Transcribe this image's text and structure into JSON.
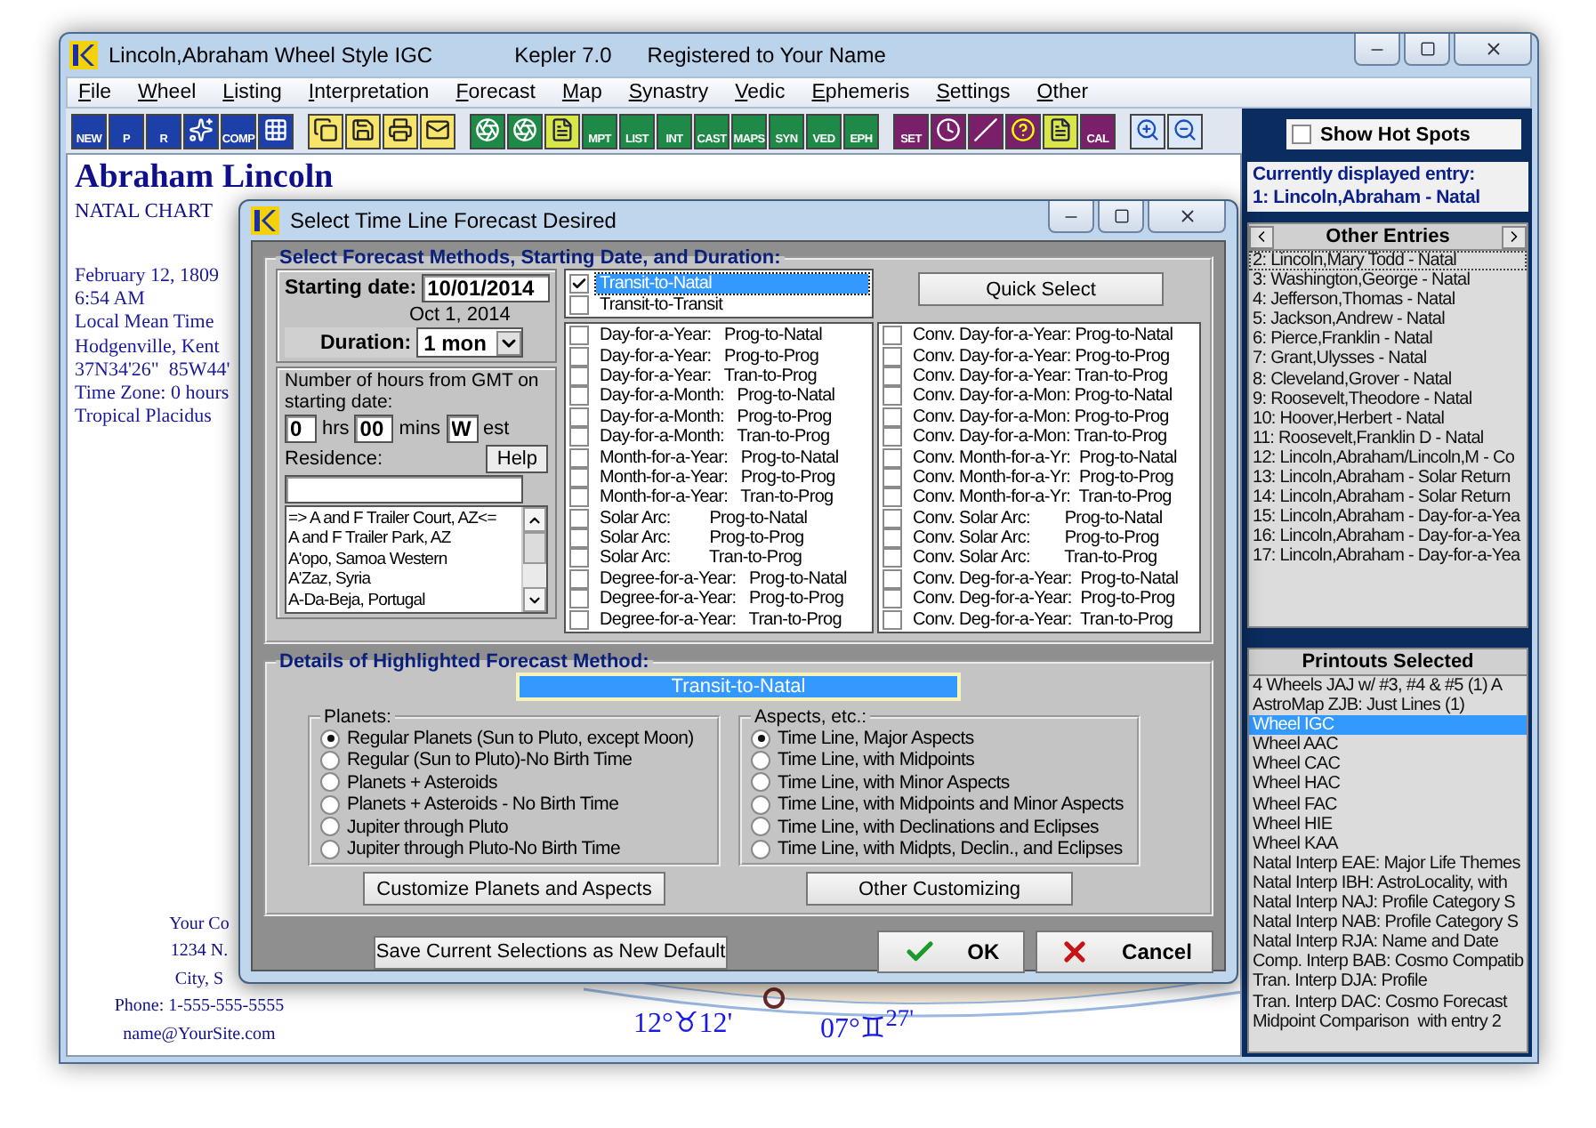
{
  "window": {
    "title": "Lincoln,Abraham Wheel Style IGC",
    "app": "Kepler 7.0",
    "registration": "Registered to Your Name"
  },
  "menu": [
    "File",
    "Wheel",
    "Listing",
    "Interpretation",
    "Forecast",
    "Map",
    "Synastry",
    "Vedic",
    "Ephemeris",
    "Settings",
    "Other"
  ],
  "toolbar_labels": [
    "NEW",
    "P",
    "R",
    "COMP",
    "MPT",
    "LIST",
    "INT",
    "CAST",
    "MAPS",
    "SYN",
    "VED",
    "EPH",
    "SET",
    "CAL"
  ],
  "chart": {
    "name": "Abraham Lincoln",
    "type": "NATAL CHART",
    "details": [
      "February 12, 1809",
      "6:54 AM",
      "Local Mean Time",
      "Hodgenville, Kent",
      "37N34'26\"  85W44'",
      "Time Zone: 0 hours",
      "Tropical Placidus"
    ],
    "contact": [
      "Your Co",
      "1234 N.",
      "City, S",
      "Phone: 1-555-555-5555",
      "name@YourSite.com"
    ],
    "degree_labels": [
      "12°♉12'",
      "07°♊$^{27'}$"
    ]
  },
  "sidebar": {
    "hot_spots": {
      "label": "Show Hot Spots",
      "checked": false
    },
    "current_label": "Currently displayed entry:",
    "current_entry": "1: Lincoln,Abraham - Natal",
    "entries_title": "Other Entries",
    "entries": [
      {
        "label": "2: Lincoln,Mary Todd - Natal",
        "focused": true
      },
      {
        "label": "3: Washington,George - Natal",
        "focused": false
      },
      {
        "label": "4: Jefferson,Thomas - Natal",
        "focused": false
      },
      {
        "label": "5: Jackson,Andrew - Natal",
        "focused": false
      },
      {
        "label": "6: Pierce,Franklin - Natal",
        "focused": false
      },
      {
        "label": "7: Grant,Ulysses - Natal",
        "focused": false
      },
      {
        "label": "8: Cleveland,Grover - Natal",
        "focused": false
      },
      {
        "label": "9: Roosevelt,Theodore - Natal",
        "focused": false
      },
      {
        "label": "10: Hoover,Herbert - Natal",
        "focused": false
      },
      {
        "label": "11: Roosevelt,Franklin D - Natal",
        "focused": false
      },
      {
        "label": "12: Lincoln,Abraham/Lincoln,M - Co",
        "focused": false
      },
      {
        "label": "13: Lincoln,Abraham - Solar Return",
        "focused": false
      },
      {
        "label": "14: Lincoln,Abraham - Solar Return",
        "focused": false
      },
      {
        "label": "15: Lincoln,Abraham - Day-for-a-Yea",
        "focused": false
      },
      {
        "label": "16: Lincoln,Abraham - Day-for-a-Yea",
        "focused": false
      },
      {
        "label": "17: Lincoln,Abraham - Day-for-a-Yea",
        "focused": false
      }
    ],
    "printouts_title": "Printouts Selected",
    "printouts": [
      {
        "label": "4 Wheels JAJ w/ #3, #4 & #5 (1) A",
        "selected": false
      },
      {
        "label": "AstroMap ZJB: Just Lines (1)",
        "selected": false
      },
      {
        "label": "Wheel IGC",
        "selected": true
      },
      {
        "label": "Wheel AAC",
        "selected": false
      },
      {
        "label": "Wheel CAC",
        "selected": false
      },
      {
        "label": "Wheel HAC",
        "selected": false
      },
      {
        "label": "Wheel FAC",
        "selected": false
      },
      {
        "label": "Wheel HIE",
        "selected": false
      },
      {
        "label": "Wheel KAA",
        "selected": false
      },
      {
        "label": "Natal Interp EAE: Major Life Themes",
        "selected": false
      },
      {
        "label": "Natal Interp IBH: AstroLocality, with",
        "selected": false
      },
      {
        "label": "Natal Interp NAJ: Profile Category S",
        "selected": false
      },
      {
        "label": "Natal Interp NAB: Profile Category S",
        "selected": false
      },
      {
        "label": "Natal Interp RJA: Name and Date",
        "selected": false
      },
      {
        "label": "Comp. Interp BAB: Cosmo Compatib",
        "selected": false
      },
      {
        "label": "Tran. Interp DJA: Profile",
        "selected": false
      },
      {
        "label": "Tran. Interp DAC: Cosmo Forecast",
        "selected": false
      },
      {
        "label": "Midpoint Comparison  with entry 2",
        "selected": false
      }
    ]
  },
  "dialog": {
    "title": "Select Time Line Forecast Desired",
    "methods_title": "Select Forecast Methods, Starting Date, and Duration:",
    "starting_date_label": "Starting date:",
    "starting_date": "10/01/2014",
    "date_text": "Oct 1, 2014",
    "duration_label": "Duration:",
    "duration": "1 mon",
    "gmt_label": "Number of hours from GMT on starting date:",
    "hours": "0",
    "hours_unit": "hrs",
    "minutes": "00",
    "minutes_unit": "mins",
    "direction": "W",
    "direction_unit": "est",
    "residence_label": "Residence:",
    "help_button": "Help",
    "residences": [
      "=> A and F Trailer Court, AZ<=",
      "A and F Trailer Park, AZ",
      "A'opo, Samoa Western",
      "A'Zaz, Syria",
      "A-Da-Beja, Portugal"
    ],
    "transit_methods": [
      {
        "label": "Transit-to-Natal",
        "checked": true,
        "selected": true
      },
      {
        "label": "Transit-to-Transit",
        "checked": false,
        "selected": false
      }
    ],
    "quick_select": "Quick Select",
    "methods_left": [
      {
        "label": "Day-for-a-Year:   Prog-to-Natal",
        "checked": false
      },
      {
        "label": "Day-for-a-Year:   Prog-to-Prog",
        "checked": false
      },
      {
        "label": "Day-for-a-Year:   Tran-to-Prog",
        "checked": false
      },
      {
        "label": "Day-for-a-Month:   Prog-to-Natal",
        "checked": false
      },
      {
        "label": "Day-for-a-Month:   Prog-to-Prog",
        "checked": false
      },
      {
        "label": "Day-for-a-Month:   Tran-to-Prog",
        "checked": false
      },
      {
        "label": "Month-for-a-Year:   Prog-to-Natal",
        "checked": false
      },
      {
        "label": "Month-for-a-Year:   Prog-to-Prog",
        "checked": false
      },
      {
        "label": "Month-for-a-Year:   Tran-to-Prog",
        "checked": false
      },
      {
        "label": "Solar Arc:         Prog-to-Natal",
        "checked": false
      },
      {
        "label": "Solar Arc:         Prog-to-Prog",
        "checked": false
      },
      {
        "label": "Solar Arc:         Tran-to-Prog",
        "checked": false
      },
      {
        "label": "Degree-for-a-Year:   Prog-to-Natal",
        "checked": false
      },
      {
        "label": "Degree-for-a-Year:   Prog-to-Prog",
        "checked": false
      },
      {
        "label": "Degree-for-a-Year:   Tran-to-Prog",
        "checked": false
      }
    ],
    "methods_right": [
      {
        "label": "Conv. Day-for-a-Year: Prog-to-Natal",
        "checked": false
      },
      {
        "label": "Conv. Day-for-a-Year: Prog-to-Prog",
        "checked": false
      },
      {
        "label": "Conv. Day-for-a-Year: Tran-to-Prog",
        "checked": false
      },
      {
        "label": "Conv. Day-for-a-Mon: Prog-to-Natal",
        "checked": false
      },
      {
        "label": "Conv. Day-for-a-Mon: Prog-to-Prog",
        "checked": false
      },
      {
        "label": "Conv. Day-for-a-Mon: Tran-to-Prog",
        "checked": false
      },
      {
        "label": "Conv. Month-for-a-Yr:  Prog-to-Natal",
        "checked": false
      },
      {
        "label": "Conv. Month-for-a-Yr:  Prog-to-Prog",
        "checked": false
      },
      {
        "label": "Conv. Month-for-a-Yr:  Tran-to-Prog",
        "checked": false
      },
      {
        "label": "Conv. Solar Arc:        Prog-to-Natal",
        "checked": false
      },
      {
        "label": "Conv. Solar Arc:        Prog-to-Prog",
        "checked": false
      },
      {
        "label": "Conv. Solar Arc:        Tran-to-Prog",
        "checked": false
      },
      {
        "label": "Conv. Deg-for-a-Year:  Prog-to-Natal",
        "checked": false
      },
      {
        "label": "Conv. Deg-for-a-Year:  Prog-to-Prog",
        "checked": false
      },
      {
        "label": "Conv. Deg-for-a-Year:  Tran-to-Prog",
        "checked": false
      }
    ],
    "details_title": "Details of Highlighted Forecast Method:",
    "highlighted_method": "Transit-to-Natal",
    "planets": {
      "title": "Planets:",
      "options": [
        {
          "label": "Regular Planets (Sun to Pluto, except Moon)",
          "selected": true
        },
        {
          "label": "Regular (Sun to Pluto)-No Birth Time",
          "selected": false
        },
        {
          "label": "Planets + Asteroids",
          "selected": false
        },
        {
          "label": "Planets + Asteroids - No Birth Time",
          "selected": false
        },
        {
          "label": "Jupiter through Pluto",
          "selected": false
        },
        {
          "label": "Jupiter through Pluto-No Birth Time",
          "selected": false
        }
      ]
    },
    "aspects": {
      "title": "Aspects, etc.:",
      "options": [
        {
          "label": "Time Line, Major Aspects",
          "selected": true
        },
        {
          "label": "Time Line, with Midpoints",
          "selected": false
        },
        {
          "label": "Time Line, with Minor Aspects",
          "selected": false
        },
        {
          "label": "Time Line, with Midpoints and Minor Aspects",
          "selected": false
        },
        {
          "label": "Time Line, with Declinations and Eclipses",
          "selected": false
        },
        {
          "label": "Time Line, with Midpts, Declin., and Eclipses",
          "selected": false
        }
      ]
    },
    "customize_button": "Customize Planets and Aspects",
    "other_button": "Other Customizing",
    "save_button": "Save Current Selections as New Default",
    "ok_button": "OK",
    "cancel_button": "Cancel"
  }
}
